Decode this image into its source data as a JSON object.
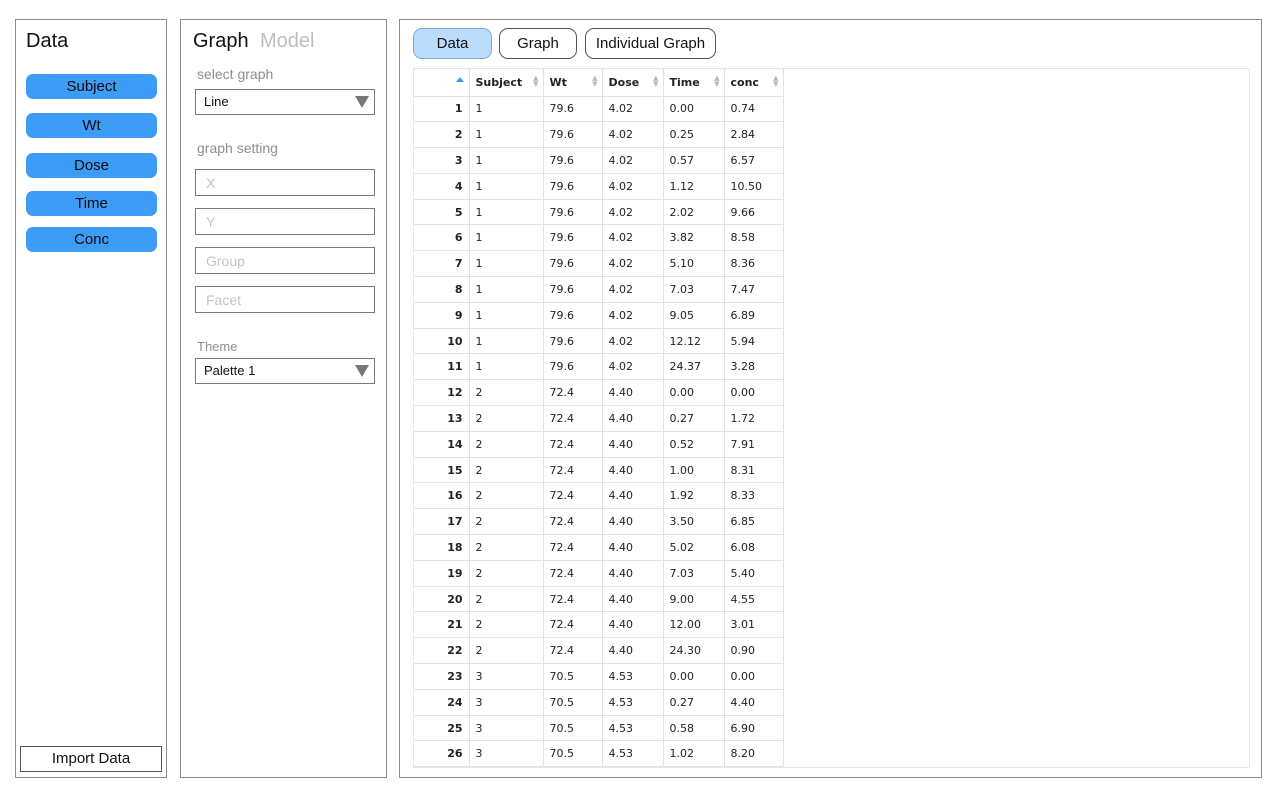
{
  "data_panel": {
    "title": "Data",
    "variables": [
      "Subject",
      "Wt",
      "Dose",
      "Time",
      "Conc"
    ],
    "import_label": "Import Data",
    "accent": "#3d9df6"
  },
  "graph_panel": {
    "tab_graph": "Graph",
    "tab_model": "Model",
    "select_graph_label": "select graph",
    "select_graph_value": "Line",
    "graph_setting_label": "graph setting",
    "x_placeholder": "X",
    "y_placeholder": "Y",
    "group_placeholder": "Group",
    "facet_placeholder": "Facet",
    "theme_label": "Theme",
    "theme_value": "Palette 1"
  },
  "main_panel": {
    "tabs": [
      "Data",
      "Graph",
      "Individual Graph"
    ],
    "active_tab": "Data",
    "active_color": "#bcdcfb"
  },
  "table": {
    "columns": [
      "Subject",
      "Wt",
      "Dose",
      "Time",
      "conc"
    ],
    "sorted_column": "row-index",
    "rows": [
      [
        "1",
        "1",
        "79.6",
        "4.02",
        "0.00",
        "0.74"
      ],
      [
        "2",
        "1",
        "79.6",
        "4.02",
        "0.25",
        "2.84"
      ],
      [
        "3",
        "1",
        "79.6",
        "4.02",
        "0.57",
        "6.57"
      ],
      [
        "4",
        "1",
        "79.6",
        "4.02",
        "1.12",
        "10.50"
      ],
      [
        "5",
        "1",
        "79.6",
        "4.02",
        "2.02",
        "9.66"
      ],
      [
        "6",
        "1",
        "79.6",
        "4.02",
        "3.82",
        "8.58"
      ],
      [
        "7",
        "1",
        "79.6",
        "4.02",
        "5.10",
        "8.36"
      ],
      [
        "8",
        "1",
        "79.6",
        "4.02",
        "7.03",
        "7.47"
      ],
      [
        "9",
        "1",
        "79.6",
        "4.02",
        "9.05",
        "6.89"
      ],
      [
        "10",
        "1",
        "79.6",
        "4.02",
        "12.12",
        "5.94"
      ],
      [
        "11",
        "1",
        "79.6",
        "4.02",
        "24.37",
        "3.28"
      ],
      [
        "12",
        "2",
        "72.4",
        "4.40",
        "0.00",
        "0.00"
      ],
      [
        "13",
        "2",
        "72.4",
        "4.40",
        "0.27",
        "1.72"
      ],
      [
        "14",
        "2",
        "72.4",
        "4.40",
        "0.52",
        "7.91"
      ],
      [
        "15",
        "2",
        "72.4",
        "4.40",
        "1.00",
        "8.31"
      ],
      [
        "16",
        "2",
        "72.4",
        "4.40",
        "1.92",
        "8.33"
      ],
      [
        "17",
        "2",
        "72.4",
        "4.40",
        "3.50",
        "6.85"
      ],
      [
        "18",
        "2",
        "72.4",
        "4.40",
        "5.02",
        "6.08"
      ],
      [
        "19",
        "2",
        "72.4",
        "4.40",
        "7.03",
        "5.40"
      ],
      [
        "20",
        "2",
        "72.4",
        "4.40",
        "9.00",
        "4.55"
      ],
      [
        "21",
        "2",
        "72.4",
        "4.40",
        "12.00",
        "3.01"
      ],
      [
        "22",
        "2",
        "72.4",
        "4.40",
        "24.30",
        "0.90"
      ],
      [
        "23",
        "3",
        "70.5",
        "4.53",
        "0.00",
        "0.00"
      ],
      [
        "24",
        "3",
        "70.5",
        "4.53",
        "0.27",
        "4.40"
      ],
      [
        "25",
        "3",
        "70.5",
        "4.53",
        "0.58",
        "6.90"
      ],
      [
        "26",
        "3",
        "70.5",
        "4.53",
        "1.02",
        "8.20"
      ]
    ]
  }
}
